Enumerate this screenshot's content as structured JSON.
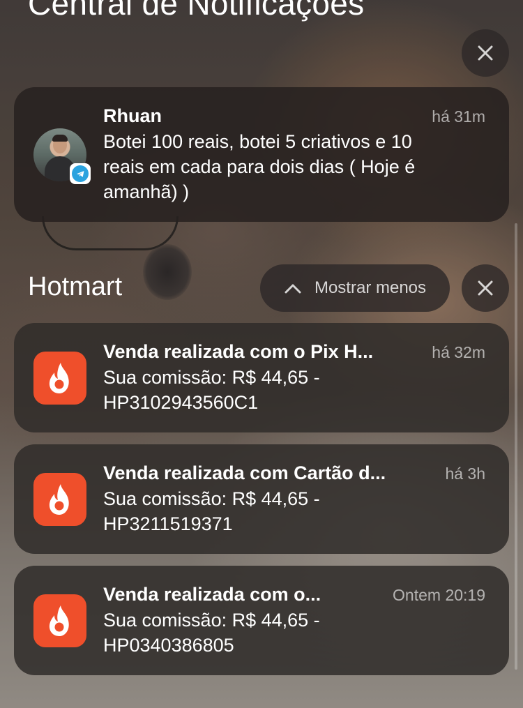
{
  "header": {
    "title": "Central de Notificações"
  },
  "telegram_notification": {
    "sender": "Rhuan",
    "time": "há 31m",
    "message_lines": [
      "Botei 100 reais, botei 5 criativos e 10",
      "reais em cada para dois dias ( Hoje é",
      "amanhã) )"
    ],
    "avatar_icon": "contact-avatar",
    "badge_icon": "telegram-icon",
    "badge_color": "#2aa3df"
  },
  "group": {
    "name": "Hotmart",
    "show_less_label": "Mostrar menos",
    "app_icon": "hotmart-flame-icon",
    "app_color": "#ef4f2b"
  },
  "notifications": [
    {
      "title": "Venda realizada com o Pix H...",
      "time": "há 32m",
      "line1": "Sua comissão: R$ 44,65 -",
      "line2": "HP3102943560C1"
    },
    {
      "title": "Venda realizada com Cartão d...",
      "time": "há 3h",
      "line1": "Sua comissão: R$ 44,65 -",
      "line2": "HP3211519371"
    },
    {
      "title": "Venda realizada com o...",
      "time": "Ontem 20:19",
      "line1": "Sua comissão: R$ 44,65 -",
      "line2": "HP0340386805"
    }
  ]
}
